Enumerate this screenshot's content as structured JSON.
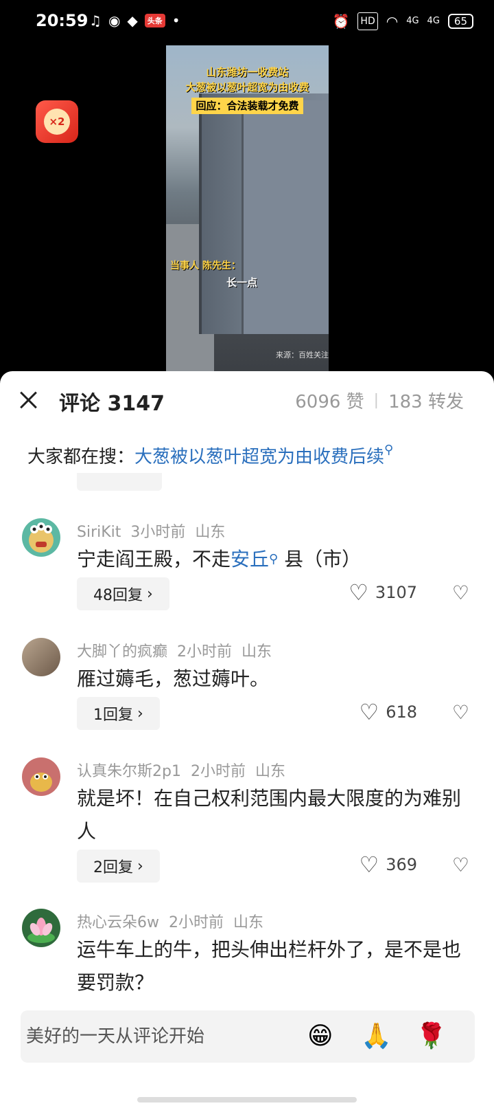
{
  "status_bar": {
    "time": "20:59",
    "app_badge": "头条",
    "network_1": "4G",
    "network_2": "4G",
    "hd_label": "HD",
    "battery": "65"
  },
  "video": {
    "title_line1": "山东潍坊一收费站",
    "title_line2": "大葱被以葱叶超宽为由收费",
    "title_line3": "回应：合法装载才免费",
    "speaker": "当事人 陈先生：",
    "subtitle": "长一点",
    "source": "来源：百姓关注",
    "reward_label": "×2"
  },
  "header": {
    "title": "评论 3147",
    "likes": "6096 赞",
    "separator": "|",
    "shares": "183 转发"
  },
  "search_tip": {
    "prefix": "大家都在搜：",
    "query": "大葱被以葱叶超宽为由收费后续"
  },
  "comments": [
    {
      "user": "SiriKit",
      "time": "3小时前",
      "location": "山东",
      "text_before": "宁走阎王殿，不走",
      "text_link": "安丘",
      "text_after": " 县（市）",
      "replies": "48回复",
      "likes": "3107"
    },
    {
      "user": "大脚丫的疯癫",
      "time": "2小时前",
      "location": "山东",
      "text": "雁过薅毛，葱过薅叶。",
      "replies": "1回复",
      "likes": "618"
    },
    {
      "user": "认真朱尔斯2p1",
      "time": "2小时前",
      "location": "山东",
      "text": "就是坏！在自己权利范围内最大限度的为难别人",
      "replies": "2回复",
      "likes": "369"
    },
    {
      "user": "热心云朵6w",
      "time": "2小时前",
      "location": "山东",
      "text": "运牛车上的牛，把头伸出栏杆外了，是不是也要罚款？"
    }
  ],
  "input": {
    "placeholder": "美好的一天从评论开始",
    "emojis": [
      "😁",
      "🙏",
      "🌹"
    ]
  },
  "icons": {
    "close": "close-icon",
    "heart": "heart-icon",
    "dislike": "broken-heart-icon",
    "search": "search-icon"
  },
  "colors": {
    "link": "#2a6fbd",
    "meta": "#999999",
    "reward": "#e53935"
  }
}
